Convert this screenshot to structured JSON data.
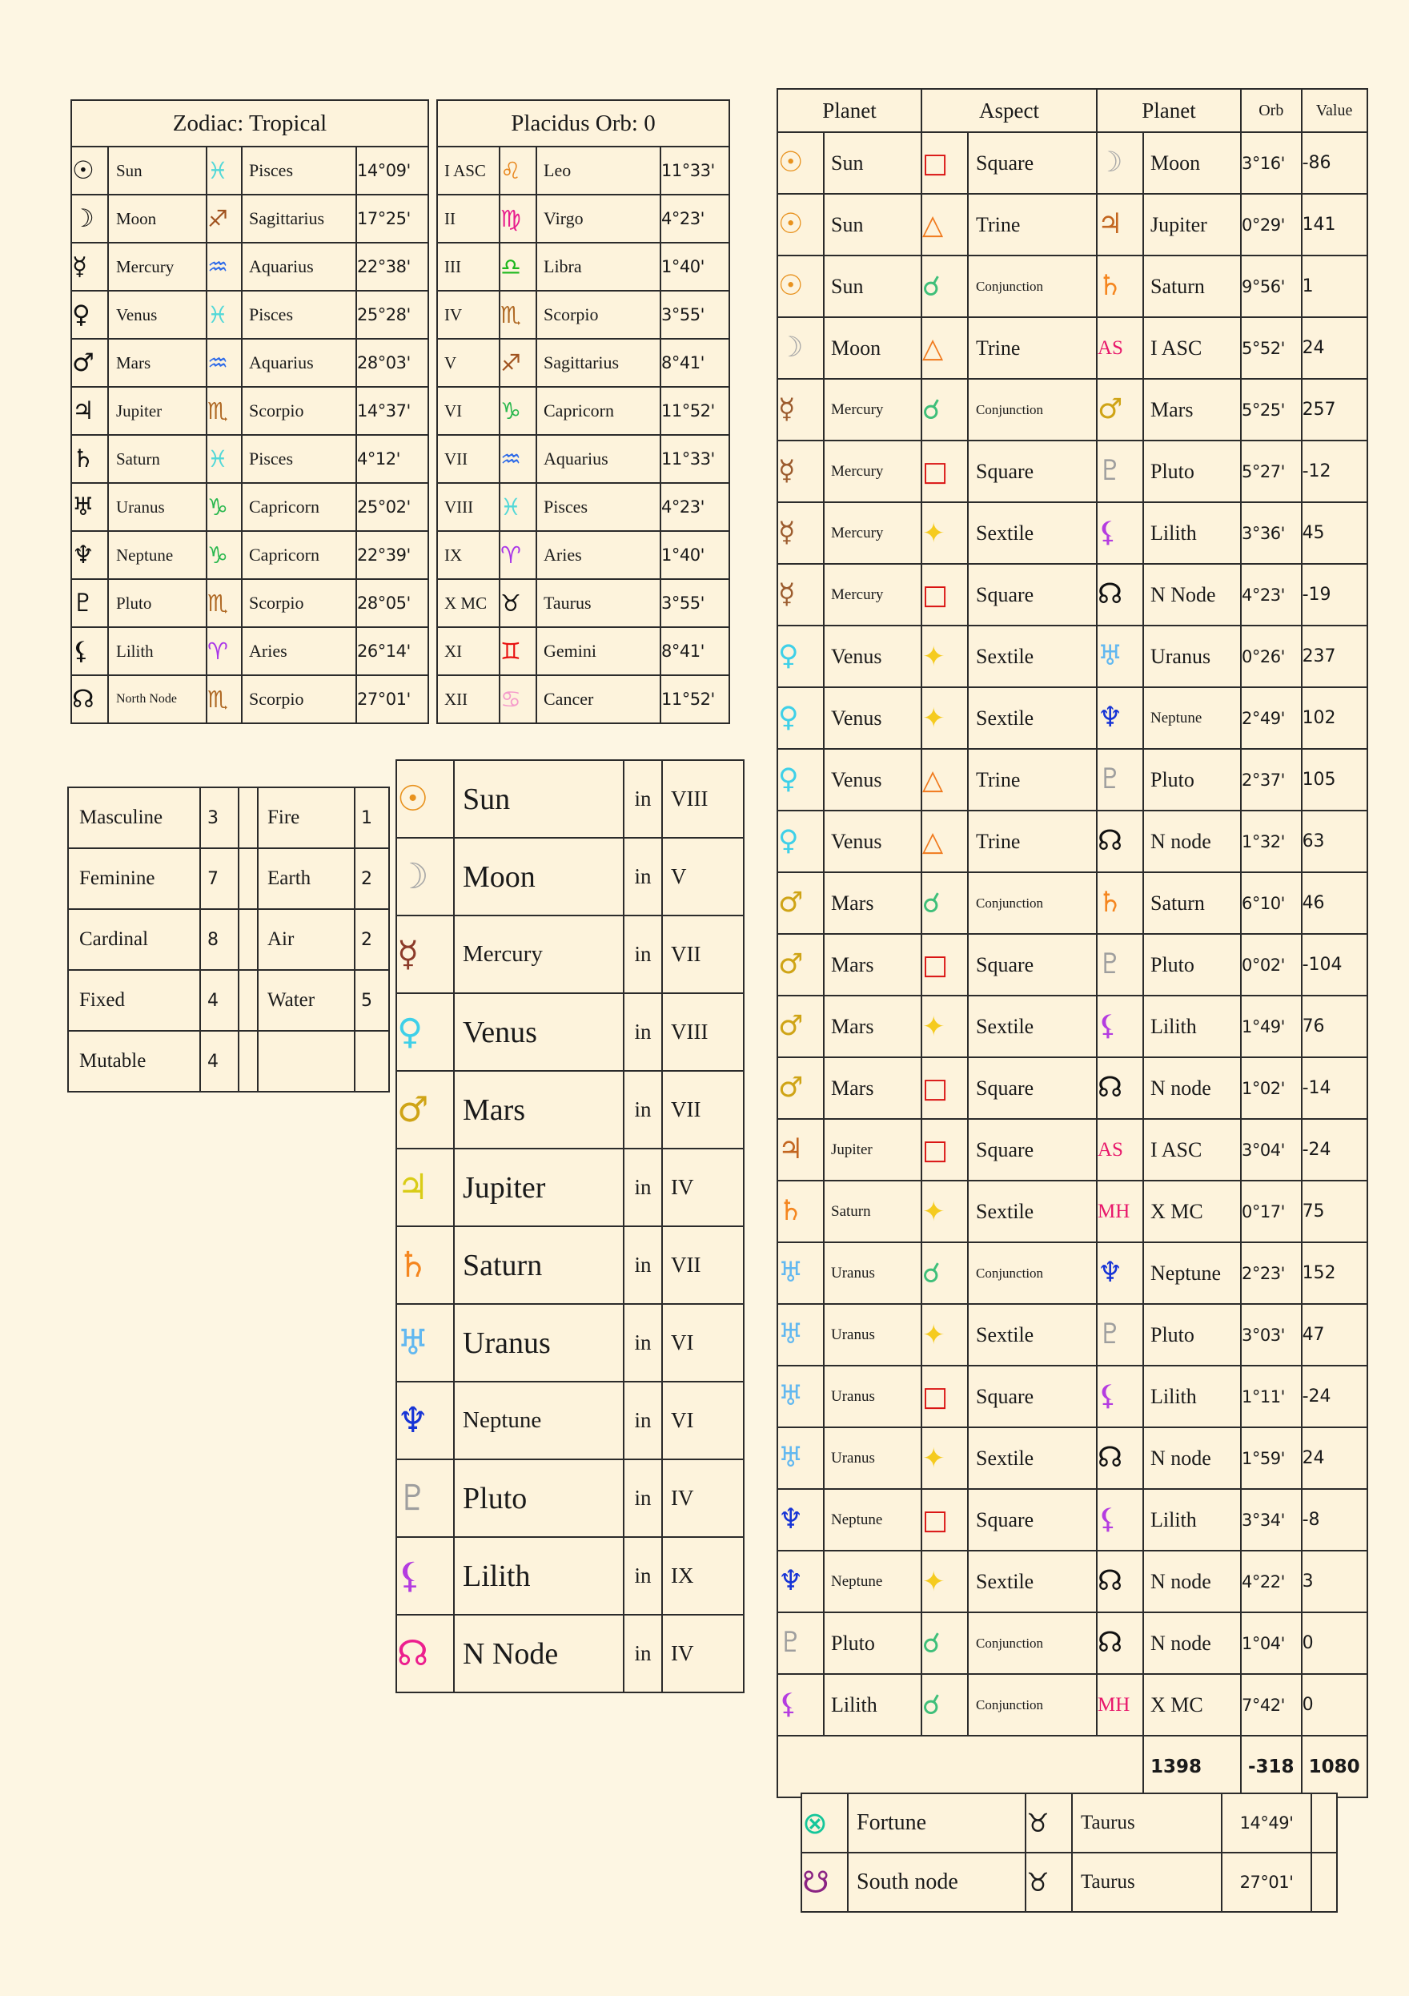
{
  "zodiac": {
    "title": "Zodiac: Tropical",
    "house_title": "Placidus Orb: 0",
    "planets": [
      {
        "glyph": "☉",
        "name": "Sun",
        "sign_glyph": "♓",
        "sign": "Pisces",
        "deg": "14°09'",
        "pc": "c-black",
        "sc": "c-pisces"
      },
      {
        "glyph": "☽",
        "name": "Moon",
        "sign_glyph": "♐",
        "sign": "Sagittarius",
        "deg": "17°25'",
        "pc": "c-black",
        "sc": "c-sagittarius"
      },
      {
        "glyph": "☿",
        "name": "Mercury",
        "sign_glyph": "♒",
        "sign": "Aquarius",
        "deg": "22°38'",
        "pc": "c-black",
        "sc": "c-aquarius"
      },
      {
        "glyph": "♀",
        "name": "Venus",
        "sign_glyph": "♓",
        "sign": "Pisces",
        "deg": "25°28'",
        "pc": "c-black",
        "sc": "c-pisces"
      },
      {
        "glyph": "♂",
        "name": "Mars",
        "sign_glyph": "♒",
        "sign": "Aquarius",
        "deg": "28°03'",
        "pc": "c-black",
        "sc": "c-aquarius"
      },
      {
        "glyph": "♃",
        "name": "Jupiter",
        "sign_glyph": "♏",
        "sign": "Scorpio",
        "deg": "14°37'",
        "pc": "c-black",
        "sc": "c-scorpio"
      },
      {
        "glyph": "♄",
        "name": "Saturn",
        "sign_glyph": "♓",
        "sign": "Pisces",
        "deg": "4°12'",
        "pc": "c-black",
        "sc": "c-pisces"
      },
      {
        "glyph": "♅",
        "name": "Uranus",
        "sign_glyph": "♑",
        "sign": "Capricorn",
        "deg": "25°02'",
        "pc": "c-black",
        "sc": "c-capricorn"
      },
      {
        "glyph": "♆",
        "name": "Neptune",
        "sign_glyph": "♑",
        "sign": "Capricorn",
        "deg": "22°39'",
        "pc": "c-black",
        "sc": "c-capricorn"
      },
      {
        "glyph": "♇",
        "name": "Pluto",
        "sign_glyph": "♏",
        "sign": "Scorpio",
        "deg": "28°05'",
        "pc": "c-black",
        "sc": "c-scorpio"
      },
      {
        "glyph": "⚸",
        "name": "Lilith",
        "sign_glyph": "♈",
        "sign": "Aries",
        "deg": "26°14'",
        "pc": "c-black",
        "sc": "c-aries"
      },
      {
        "glyph": "☊",
        "name": "North Node",
        "sign_glyph": "♏",
        "sign": "Scorpio",
        "deg": "27°01'",
        "pc": "c-black",
        "sc": "c-scorpio",
        "small": true
      }
    ],
    "houses": [
      {
        "num": "I ASC",
        "sign_glyph": "♌",
        "sign": "Leo",
        "deg": "11°33'",
        "sc": "c-leo"
      },
      {
        "num": "II",
        "sign_glyph": "♍",
        "sign": "Virgo",
        "deg": "4°23'",
        "sc": "c-virgo"
      },
      {
        "num": "III",
        "sign_glyph": "♎",
        "sign": "Libra",
        "deg": "1°40'",
        "sc": "c-libra"
      },
      {
        "num": "IV",
        "sign_glyph": "♏",
        "sign": "Scorpio",
        "deg": "3°55'",
        "sc": "c-scorpio"
      },
      {
        "num": "V",
        "sign_glyph": "♐",
        "sign": "Sagittarius",
        "deg": "8°41'",
        "sc": "c-sagittarius"
      },
      {
        "num": "VI",
        "sign_glyph": "♑",
        "sign": "Capricorn",
        "deg": "11°52'",
        "sc": "c-capricorn"
      },
      {
        "num": "VII",
        "sign_glyph": "♒",
        "sign": "Aquarius",
        "deg": "11°33'",
        "sc": "c-aquarius"
      },
      {
        "num": "VIII",
        "sign_glyph": "♓",
        "sign": "Pisces",
        "deg": "4°23'",
        "sc": "c-pisces"
      },
      {
        "num": "IX",
        "sign_glyph": "♈",
        "sign": "Aries",
        "deg": "1°40'",
        "sc": "c-aries"
      },
      {
        "num": "X MC",
        "sign_glyph": "♉",
        "sign": "Taurus",
        "deg": "3°55'",
        "sc": "c-taurus"
      },
      {
        "num": "XI",
        "sign_glyph": "♊",
        "sign": "Gemini",
        "deg": "8°41'",
        "sc": "c-gemini"
      },
      {
        "num": "XII",
        "sign_glyph": "♋",
        "sign": "Cancer",
        "deg": "11°52'",
        "sc": "c-cancer"
      }
    ]
  },
  "elements": {
    "rows": [
      {
        "label": "Masculine",
        "value": "3",
        "label2": "Fire",
        "value2": "1"
      },
      {
        "label": "Feminine",
        "value": "7",
        "label2": "Earth",
        "value2": "2"
      },
      {
        "label": "Cardinal",
        "value": "8",
        "label2": "Air",
        "value2": "2"
      },
      {
        "label": "Fixed",
        "value": "4",
        "label2": "Water",
        "value2": "5"
      },
      {
        "label": "Mutable",
        "value": "4",
        "label2": "",
        "value2": ""
      }
    ]
  },
  "planet_in_house": {
    "in_label": "in",
    "rows": [
      {
        "glyph": "☉",
        "name": "Sun",
        "house": "VIII",
        "c": "c-sun"
      },
      {
        "glyph": "☽",
        "name": "Moon",
        "house": "V",
        "c": "c-moon"
      },
      {
        "glyph": "☿",
        "name": "Mercury",
        "house": "VII",
        "c": "c-mercury",
        "small": true
      },
      {
        "glyph": "♀",
        "name": "Venus",
        "house": "VIII",
        "c": "c-venus"
      },
      {
        "glyph": "♂",
        "name": "Mars",
        "house": "VII",
        "c": "c-mars"
      },
      {
        "glyph": "♃",
        "name": "Jupiter",
        "house": "IV",
        "c": "c-jupiter"
      },
      {
        "glyph": "♄",
        "name": "Saturn",
        "house": "VII",
        "c": "c-saturn"
      },
      {
        "glyph": "♅",
        "name": "Uranus",
        "house": "VI",
        "c": "c-uranus"
      },
      {
        "glyph": "♆",
        "name": "Neptune",
        "house": "VI",
        "c": "c-neptune",
        "small": true
      },
      {
        "glyph": "♇",
        "name": "Pluto",
        "house": "IV",
        "c": "c-pluto"
      },
      {
        "glyph": "⚸",
        "name": "Lilith",
        "house": "IX",
        "c": "c-lilith"
      },
      {
        "glyph": "☊",
        "name": "N Node",
        "house": "IV",
        "c": "c-nnode"
      }
    ]
  },
  "aspects": {
    "headers": {
      "planet1": "Planet",
      "aspect": "Aspect",
      "planet2": "Planet",
      "orb": "Orb",
      "value": "Value"
    },
    "rows": [
      {
        "p1g": "☉",
        "p1": "Sun",
        "p1c": "c-sun",
        "ag": "□",
        "asp": "Square",
        "ac": "c-square",
        "p2g": "☽",
        "p2": "Moon",
        "p2c": "c-moon",
        "orb": "3°16'",
        "val": "-86"
      },
      {
        "p1g": "☉",
        "p1": "Sun",
        "p1c": "c-sun",
        "ag": "△",
        "asp": "Trine",
        "ac": "c-trine",
        "p2g": "♃",
        "p2": "Jupiter",
        "p2c": "c-jupbrown",
        "orb": "0°29'",
        "val": "141"
      },
      {
        "p1g": "☉",
        "p1": "Sun",
        "p1c": "c-sun",
        "ag": "☌",
        "asp": "Conjunction",
        "ac": "c-conj",
        "p2g": "♄",
        "p2": "Saturn",
        "p2c": "c-saturn",
        "orb": "9°56'",
        "val": "1",
        "asp_small": true
      },
      {
        "p1g": "☽",
        "p1": "Moon",
        "p1c": "c-moon",
        "ag": "△",
        "asp": "Trine",
        "ac": "c-trine",
        "p2g": "AS",
        "p2": "I ASC",
        "p2c": "c-asc",
        "orb": "5°52'",
        "val": "24",
        "p2txt": true
      },
      {
        "p1g": "☿",
        "p1": "Mercury",
        "p1c": "c-mercbrown",
        "ag": "☌",
        "asp": "Conjunction",
        "ac": "c-conj",
        "p2g": "♂",
        "p2": "Mars",
        "p2c": "c-mars",
        "orb": "5°25'",
        "val": "257",
        "p1_small": true,
        "asp_small": true
      },
      {
        "p1g": "☿",
        "p1": "Mercury",
        "p1c": "c-mercbrown",
        "ag": "□",
        "asp": "Square",
        "ac": "c-square",
        "p2g": "♇",
        "p2": "Pluto",
        "p2c": "c-pluto",
        "orb": "5°27'",
        "val": "-12",
        "p1_small": true
      },
      {
        "p1g": "☿",
        "p1": "Mercury",
        "p1c": "c-mercbrown",
        "ag": "✦",
        "asp": "Sextile",
        "ac": "c-sextile",
        "p2g": "⚸",
        "p2": "Lilith",
        "p2c": "c-lilith",
        "orb": "3°36'",
        "val": "45",
        "p1_small": true
      },
      {
        "p1g": "☿",
        "p1": "Mercury",
        "p1c": "c-mercbrown",
        "ag": "□",
        "asp": "Square",
        "ac": "c-square",
        "p2g": "☊",
        "p2": "N Node",
        "p2c": "c-black",
        "orb": "4°23'",
        "val": "-19",
        "p1_small": true
      },
      {
        "p1g": "♀",
        "p1": "Venus",
        "p1c": "c-venus",
        "ag": "✦",
        "asp": "Sextile",
        "ac": "c-sextile",
        "p2g": "♅",
        "p2": "Uranus",
        "p2c": "c-uranus",
        "orb": "0°26'",
        "val": "237"
      },
      {
        "p1g": "♀",
        "p1": "Venus",
        "p1c": "c-venus",
        "ag": "✦",
        "asp": "Sextile",
        "ac": "c-sextile",
        "p2g": "♆",
        "p2": "Neptune",
        "p2c": "c-neptune",
        "orb": "2°49'",
        "val": "102",
        "p2_small": true
      },
      {
        "p1g": "♀",
        "p1": "Venus",
        "p1c": "c-venus",
        "ag": "△",
        "asp": "Trine",
        "ac": "c-trine",
        "p2g": "♇",
        "p2": "Pluto",
        "p2c": "c-pluto",
        "orb": "2°37'",
        "val": "105"
      },
      {
        "p1g": "♀",
        "p1": "Venus",
        "p1c": "c-venus",
        "ag": "△",
        "asp": "Trine",
        "ac": "c-trine",
        "p2g": "☊",
        "p2": "N node",
        "p2c": "c-black",
        "orb": "1°32'",
        "val": "63"
      },
      {
        "p1g": "♂",
        "p1": "Mars",
        "p1c": "c-mars",
        "ag": "☌",
        "asp": "Conjunction",
        "ac": "c-conj",
        "p2g": "♄",
        "p2": "Saturn",
        "p2c": "c-saturn",
        "orb": "6°10'",
        "val": "46",
        "asp_small": true
      },
      {
        "p1g": "♂",
        "p1": "Mars",
        "p1c": "c-mars",
        "ag": "□",
        "asp": "Square",
        "ac": "c-square",
        "p2g": "♇",
        "p2": "Pluto",
        "p2c": "c-pluto",
        "orb": "0°02'",
        "val": "-104"
      },
      {
        "p1g": "♂",
        "p1": "Mars",
        "p1c": "c-mars",
        "ag": "✦",
        "asp": "Sextile",
        "ac": "c-sextile",
        "p2g": "⚸",
        "p2": "Lilith",
        "p2c": "c-lilith",
        "orb": "1°49'",
        "val": "76"
      },
      {
        "p1g": "♂",
        "p1": "Mars",
        "p1c": "c-mars",
        "ag": "□",
        "asp": "Square",
        "ac": "c-square",
        "p2g": "☊",
        "p2": "N node",
        "p2c": "c-black",
        "orb": "1°02'",
        "val": "-14"
      },
      {
        "p1g": "♃",
        "p1": "Jupiter",
        "p1c": "c-jupbrown",
        "ag": "□",
        "asp": "Square",
        "ac": "c-square",
        "p2g": "AS",
        "p2": "I ASC",
        "p2c": "c-asc",
        "orb": "3°04'",
        "val": "-24",
        "p1_small": true,
        "p2txt": true
      },
      {
        "p1g": "♄",
        "p1": "Saturn",
        "p1c": "c-saturn",
        "ag": "✦",
        "asp": "Sextile",
        "ac": "c-sextile",
        "p2g": "MH",
        "p2": "X MC",
        "p2c": "c-mc",
        "orb": "0°17'",
        "val": "75",
        "p1_small": true,
        "p2txt": true
      },
      {
        "p1g": "♅",
        "p1": "Uranus",
        "p1c": "c-uranus",
        "ag": "☌",
        "asp": "Conjunction",
        "ac": "c-conj",
        "p2g": "♆",
        "p2": "Neptune",
        "p2c": "c-neptune",
        "orb": "2°23'",
        "val": "152",
        "p1_small": true,
        "asp_small": true
      },
      {
        "p1g": "♅",
        "p1": "Uranus",
        "p1c": "c-uranus",
        "ag": "✦",
        "asp": "Sextile",
        "ac": "c-sextile",
        "p2g": "♇",
        "p2": "Pluto",
        "p2c": "c-pluto",
        "orb": "3°03'",
        "val": "47",
        "p1_small": true
      },
      {
        "p1g": "♅",
        "p1": "Uranus",
        "p1c": "c-uranus",
        "ag": "□",
        "asp": "Square",
        "ac": "c-square",
        "p2g": "⚸",
        "p2": "Lilith",
        "p2c": "c-lilith",
        "orb": "1°11'",
        "val": "-24",
        "p1_small": true
      },
      {
        "p1g": "♅",
        "p1": "Uranus",
        "p1c": "c-uranus",
        "ag": "✦",
        "asp": "Sextile",
        "ac": "c-sextile",
        "p2g": "☊",
        "p2": "N node",
        "p2c": "c-black",
        "orb": "1°59'",
        "val": "24",
        "p1_small": true
      },
      {
        "p1g": "♆",
        "p1": "Neptune",
        "p1c": "c-neptune",
        "ag": "□",
        "asp": "Square",
        "ac": "c-square",
        "p2g": "⚸",
        "p2": "Lilith",
        "p2c": "c-lilith",
        "orb": "3°34'",
        "val": "-8",
        "p1_small": true
      },
      {
        "p1g": "♆",
        "p1": "Neptune",
        "p1c": "c-neptune",
        "ag": "✦",
        "asp": "Sextile",
        "ac": "c-sextile",
        "p2g": "☊",
        "p2": "N node",
        "p2c": "c-black",
        "orb": "4°22'",
        "val": "3",
        "p1_small": true
      },
      {
        "p1g": "♇",
        "p1": "Pluto",
        "p1c": "c-pluto",
        "ag": "☌",
        "asp": "Conjunction",
        "ac": "c-conj",
        "p2g": "☊",
        "p2": "N node",
        "p2c": "c-black",
        "orb": "1°04'",
        "val": "0",
        "asp_small": true
      },
      {
        "p1g": "⚸",
        "p1": "Lilith",
        "p1c": "c-lilith",
        "ag": "☌",
        "asp": "Conjunction",
        "ac": "c-conj",
        "p2g": "MH",
        "p2": "X MC",
        "p2c": "c-mc",
        "orb": "7°42'",
        "val": "0",
        "asp_small": true,
        "p2txt": true
      }
    ],
    "totals": {
      "sum": "1398",
      "orb": "-318",
      "value": "1080"
    }
  },
  "fortune": {
    "rows": [
      {
        "glyph": "⊗",
        "name": "Fortune",
        "c": "c-fortune",
        "sign_glyph": "♉",
        "sign": "Taurus",
        "deg": "14°49'"
      },
      {
        "glyph": "☋",
        "name": "South node",
        "c": "c-southnode",
        "sign_glyph": "♉",
        "sign": "Taurus",
        "deg": "27°01'"
      }
    ]
  }
}
